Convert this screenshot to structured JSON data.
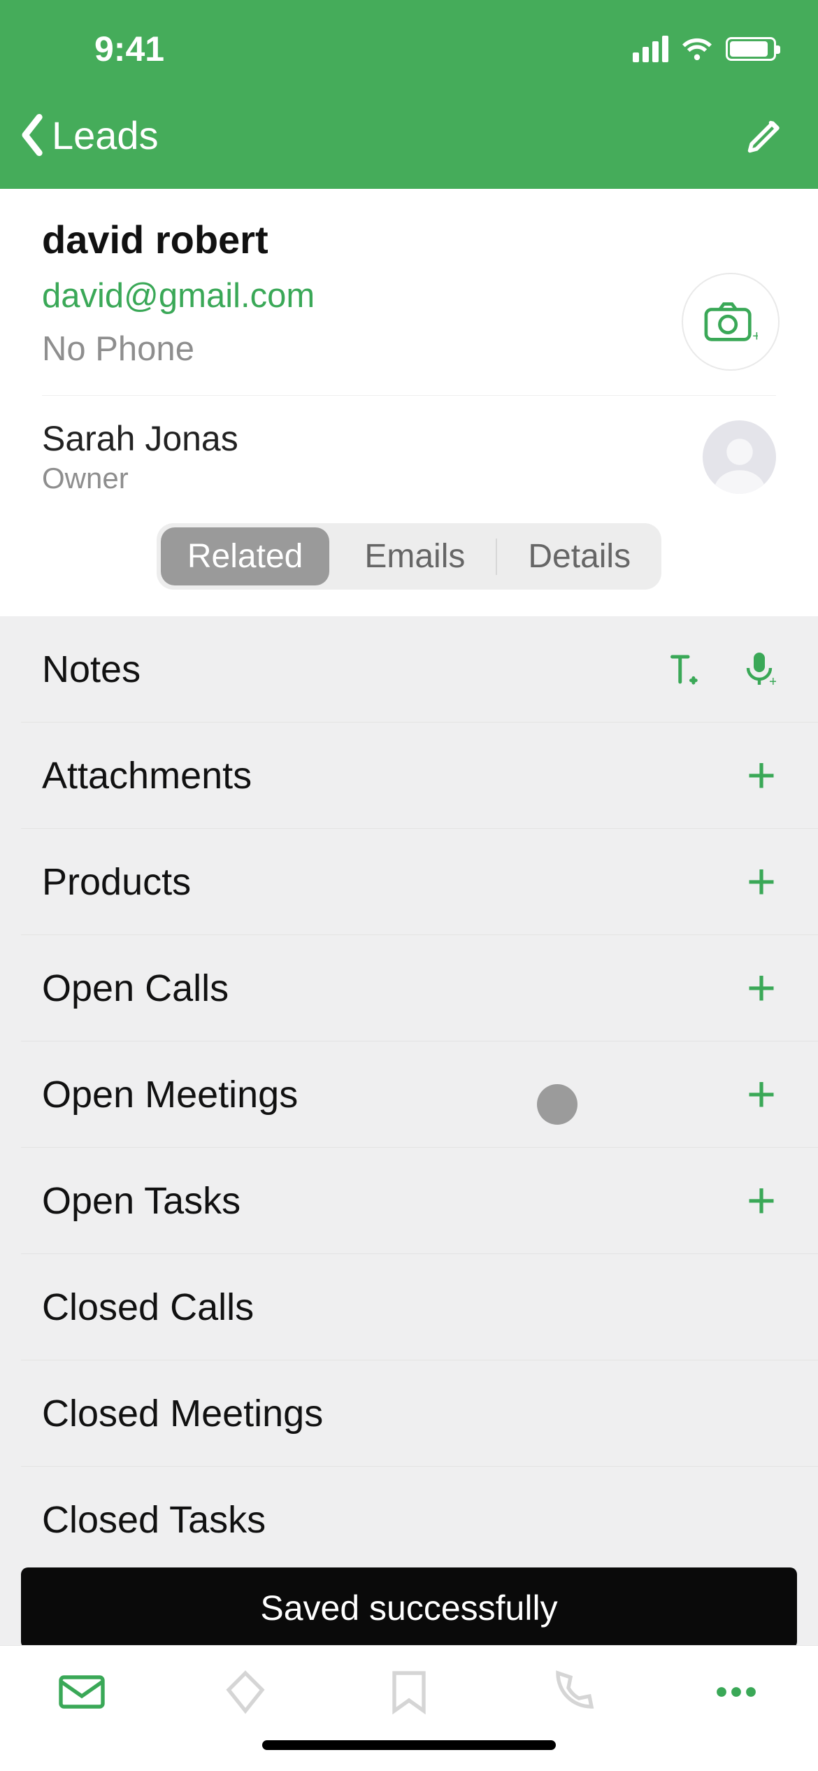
{
  "status": {
    "time": "9:41"
  },
  "nav": {
    "back_label": "Leads"
  },
  "lead": {
    "name": "david robert",
    "email": "david@gmail.com",
    "phone": "No Phone"
  },
  "owner": {
    "name": "Sarah Jonas",
    "role": "Owner"
  },
  "tabs": {
    "related": "Related",
    "emails": "Emails",
    "details": "Details",
    "active": "related"
  },
  "sections": {
    "notes": "Notes",
    "attachments": "Attachments",
    "products": "Products",
    "open_calls": "Open Calls",
    "open_meetings": "Open Meetings",
    "open_tasks": "Open Tasks",
    "closed_calls": "Closed Calls",
    "closed_meetings": "Closed Meetings",
    "closed_tasks": "Closed Tasks"
  },
  "toast": {
    "message": "Saved successfully"
  },
  "colors": {
    "accent": "#45ac5a"
  }
}
